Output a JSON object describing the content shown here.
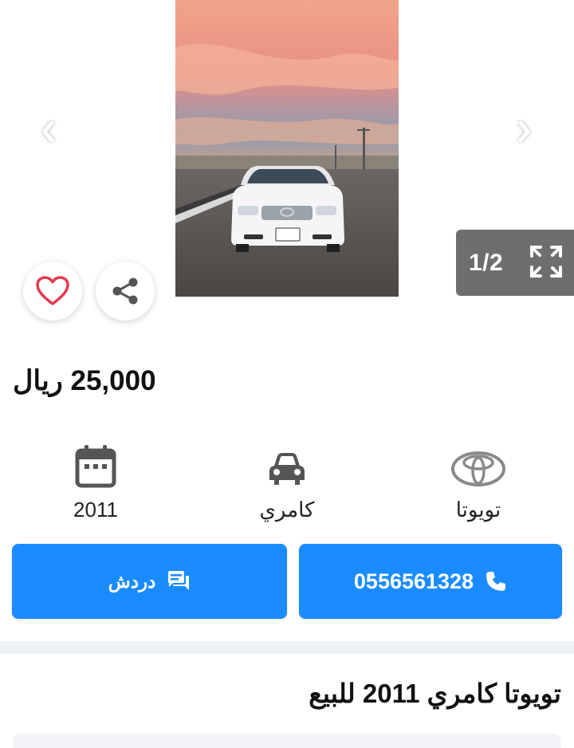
{
  "gallery": {
    "counter": "1/2",
    "photo_subject": "white toyota camry at sunset",
    "prev_icon": "chevron-left-icon",
    "next_icon": "chevron-right-icon",
    "expand_icon": "fullscreen-expand-icon"
  },
  "actions": {
    "favorite_icon": "heart-icon",
    "share_icon": "share-icon"
  },
  "price": {
    "amount": "25,000",
    "currency": "ريال"
  },
  "specs": {
    "year": "2011",
    "model": "كامري",
    "make": "تويوتا",
    "year_icon": "calendar-icon",
    "model_icon": "car-icon",
    "make_icon": "toyota-logo-icon"
  },
  "buttons": {
    "phone": "0556561328",
    "chat": "دردش",
    "phone_icon": "phone-icon",
    "chat_icon": "chat-icon"
  },
  "listing": {
    "title": "تويوتا كامري 2011 للبيع"
  },
  "colors": {
    "accent": "#1a8cff",
    "counter_bg": "#6e6e6e",
    "heart": "#e53950",
    "divider": "#eef1f6"
  }
}
